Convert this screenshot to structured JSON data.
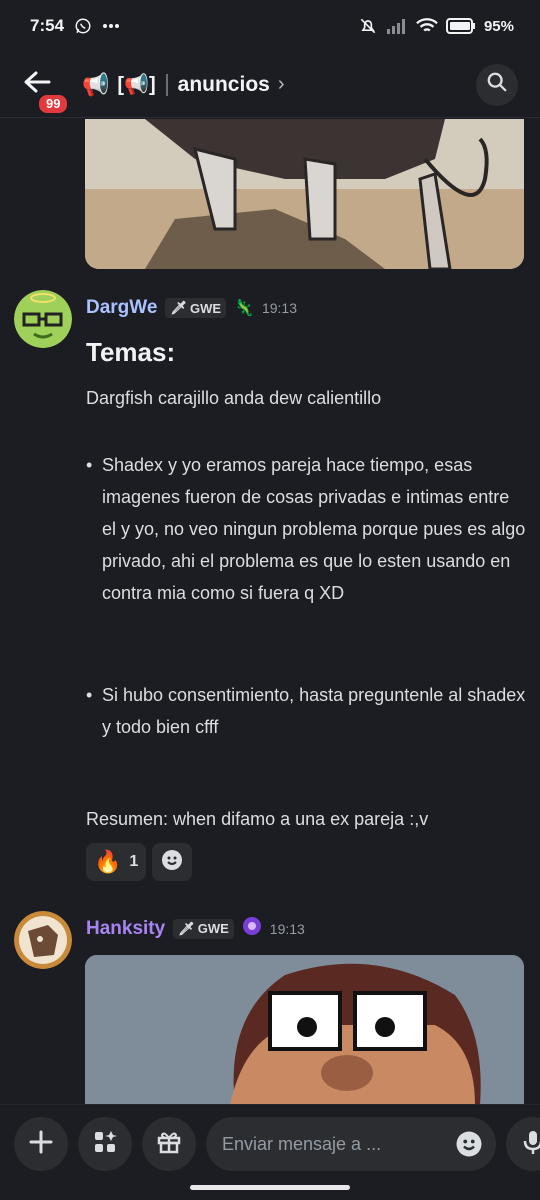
{
  "status_bar": {
    "time": "7:54",
    "battery": "95%",
    "icons": [
      "whatsapp-icon",
      "more-dots-icon",
      "bell-muted-icon",
      "signal-icon",
      "wifi-icon",
      "battery-icon"
    ]
  },
  "header": {
    "badge_count": "99",
    "channel_emoji_1": "📢",
    "channel_emoji_2": "[📢]",
    "channel_name": "anuncios",
    "chevron": "›"
  },
  "messages": [
    {
      "author": "DargWe",
      "author_color": "#a9c2ff",
      "tag": "GWE",
      "tag_icon": "🗡",
      "extra_emoji": "🦎",
      "timestamp": "19:13",
      "heading": "Temas:",
      "intro": "Dargfish carajillo anda dew calientillo",
      "bullets": [
        "Shadex y yo eramos pareja hace tiempo, esas imagenes fueron de cosas privadas e intimas entre el y yo, no veo ningun problema porque pues es algo privado, ahi el problema es que lo esten usando en contra mia como si fuera q XD",
        "Si hubo consentimiento, hasta preguntenle al shadex y todo bien cfff"
      ],
      "summary": "Resumen: when difamo a una ex pareja :,v",
      "reactions": [
        {
          "emoji": "🔥",
          "count": "1"
        }
      ]
    },
    {
      "author": "Hanksity",
      "author_color": "#a884f3",
      "tag": "GWE",
      "tag_icon": "🗡",
      "extra_emoji": "🟣",
      "timestamp": "19:13"
    }
  ],
  "composer": {
    "placeholder": "Enviar mensaje a ..."
  }
}
